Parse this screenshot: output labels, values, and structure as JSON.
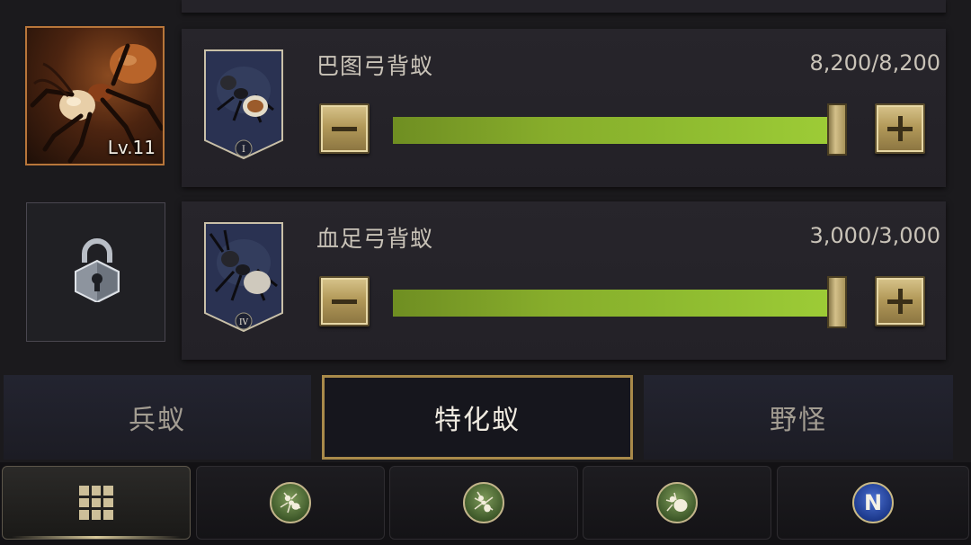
{
  "hero": {
    "level_label": "Lv.11"
  },
  "troops": [
    {
      "name": "巴图弓背蚁",
      "count": "8,200/8,200",
      "rank": "I",
      "fill": 1.0
    },
    {
      "name": "血足弓背蚁",
      "count": "3,000/3,000",
      "rank": "IV",
      "fill": 1.0
    }
  ],
  "tabs": [
    {
      "label": "兵蚁",
      "active": false
    },
    {
      "label": "特化蚁",
      "active": true
    },
    {
      "label": "野怪",
      "active": false
    }
  ],
  "nav": {
    "n_label": "N",
    "icons": [
      "grid-icon",
      "ant-icon",
      "ant-icon",
      "ant-icon",
      "n-icon"
    ]
  },
  "colors": {
    "bar_fill": "#8db92f",
    "gold_accent": "#a98a4a",
    "portrait_border": "#b8763a"
  }
}
